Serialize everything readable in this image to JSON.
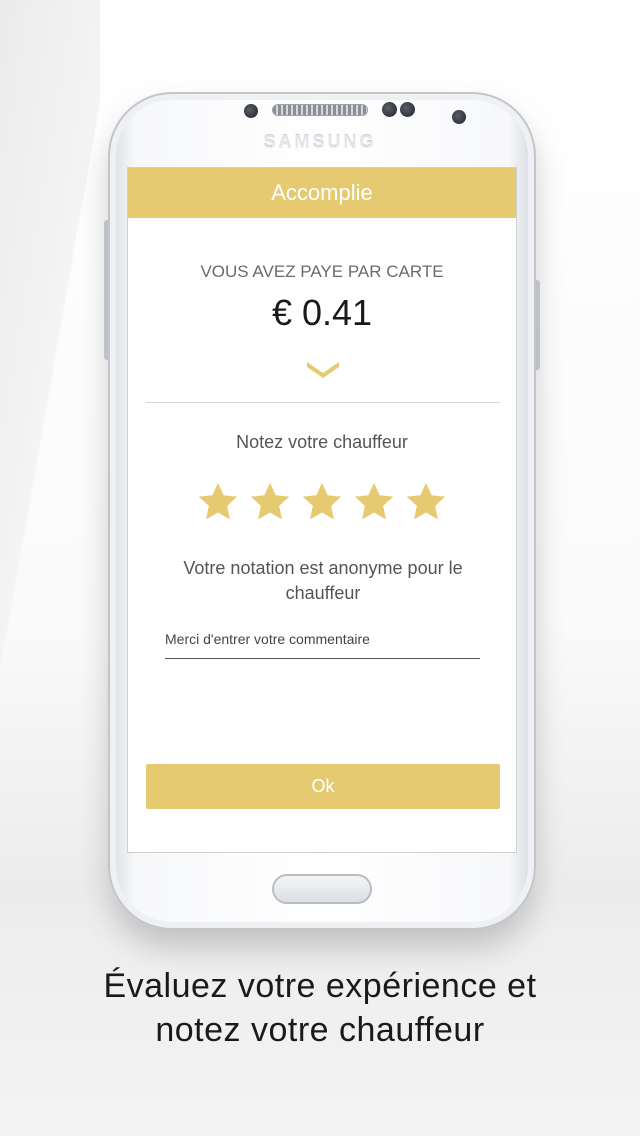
{
  "device": {
    "brand": "SAMSUNG"
  },
  "screen": {
    "title": "Accomplie",
    "payment_label": "VOUS AVEZ PAYE PAR CARTE",
    "amount": "€ 0.41",
    "rating_label": "Notez votre chauffeur",
    "rating": {
      "value": 5,
      "max": 5
    },
    "anonymous_note": "Votre notation est anonyme pour le chauffeur",
    "comment_placeholder": "Merci d'entrer votre commentaire",
    "ok_label": "Ok"
  },
  "caption": {
    "line1": "Évaluez votre expérience et",
    "line2": "notez votre chauffeur"
  },
  "colors": {
    "accent": "#e6ca72",
    "text": "#555555"
  },
  "icons": {
    "expand": "chevron-down-icon",
    "star": "star-icon"
  }
}
